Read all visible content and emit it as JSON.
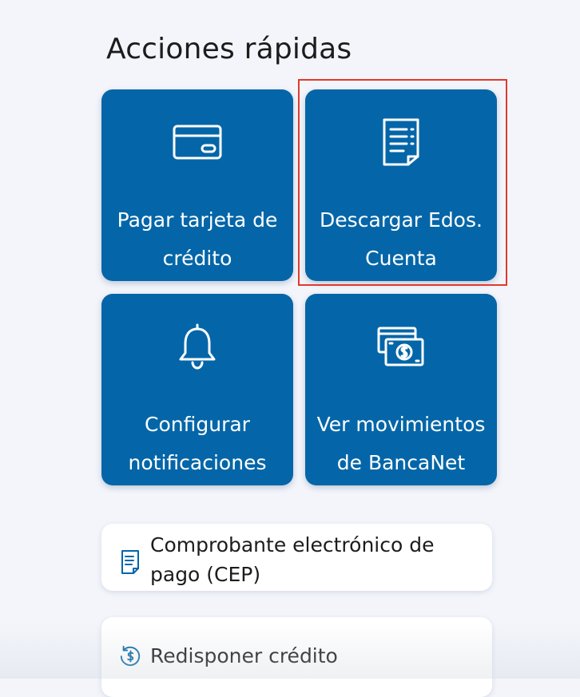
{
  "header": {
    "title": "Acciones rápidas"
  },
  "quick_actions": [
    {
      "label": "Pagar tarjeta de crédito",
      "icon": "credit-card-icon"
    },
    {
      "label": "Descargar Edos. Cuenta",
      "icon": "document-icon"
    },
    {
      "label": "Configurar notificaciones",
      "icon": "bell-icon"
    },
    {
      "label": "Ver movimientos de BancaNet",
      "icon": "money-bills-icon"
    }
  ],
  "list_actions": [
    {
      "label": "Comprobante electrónico de pago (CEP)",
      "icon": "receipt-icon"
    },
    {
      "label": "Redisponer crédito",
      "icon": "dollar-refresh-icon"
    }
  ],
  "colors": {
    "background": "#f3f5fb",
    "tile": "#0466a8",
    "highlight": "#e03a2c",
    "list_icon": "#0466a8"
  }
}
